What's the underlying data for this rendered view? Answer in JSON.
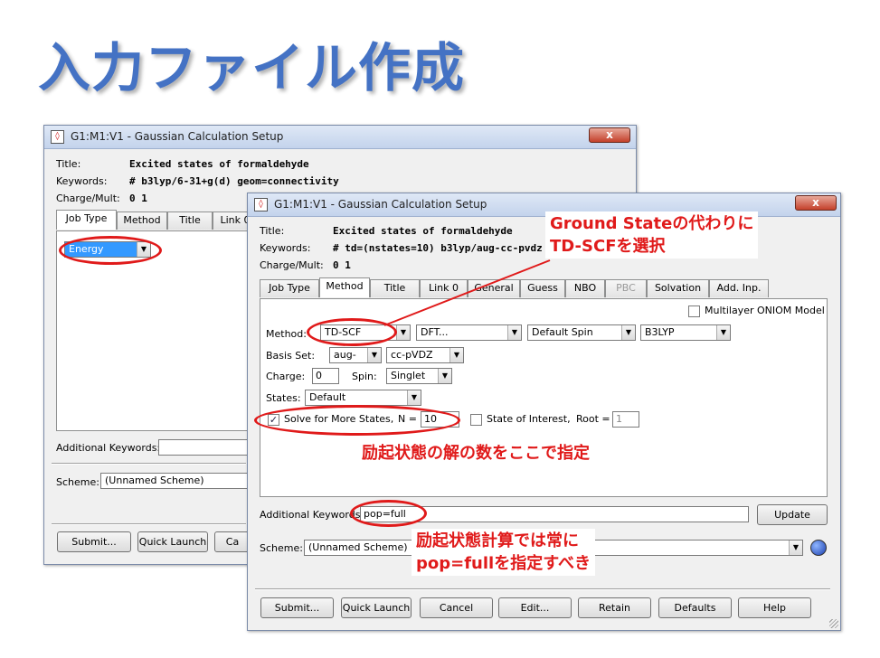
{
  "slide": {
    "title": "入力ファイル作成"
  },
  "back_window": {
    "title": "G1:M1:V1 - Gaussian Calculation Setup",
    "close_label": "x",
    "title_label": "Title:",
    "title_value": "Excited states of formaldehyde",
    "keywords_label": "Keywords:",
    "keywords_value": "# b3lyp/6-31+g(d) geom=connectivity",
    "charge_label": "Charge/Mult:",
    "charge_value": "0 1",
    "tabs": [
      "Job Type",
      "Method",
      "Title",
      "Link 0"
    ],
    "job_type_value": "Energy",
    "additional_keywords_label": "Additional Keywords:",
    "scheme_label": "Scheme:",
    "scheme_value": "(Unnamed Scheme)",
    "buttons": [
      "Submit...",
      "Quick Launch",
      "Ca"
    ]
  },
  "front_window": {
    "title": "G1:M1:V1 - Gaussian Calculation Setup",
    "close_label": "x",
    "title_label": "Title:",
    "title_value": "Excited states of formaldehyde",
    "keywords_label": "Keywords:",
    "keywords_value": "# td=(nstates=10) b3lyp/aug-cc-pvdz g",
    "charge_label": "Charge/Mult:",
    "charge_value": "0 1",
    "tabs": [
      "Job Type",
      "Method",
      "Title",
      "Link 0",
      "General",
      "Guess",
      "NBO",
      "PBC",
      "Solvation",
      "Add. Inp."
    ],
    "active_tab": "Method",
    "disabled_tab": "PBC",
    "multilayer_label": "Multilayer ONIOM Model",
    "method_label": "Method:",
    "method_value": "TD-SCF",
    "method_type": "DFT...",
    "spin_mode": "Default Spin",
    "functional": "B3LYP",
    "basis_label": "Basis Set:",
    "basis_prefix": "aug-",
    "basis_value": "cc-pVDZ",
    "charge_field_label": "Charge:",
    "charge_field_value": "0",
    "spin_label": "Spin:",
    "spin_value": "Singlet",
    "states_label": "States:",
    "states_value": "Default",
    "solve_more_label": "Solve for More States,",
    "n_label": "N =",
    "n_value": "10",
    "state_interest_label": "State of Interest,",
    "root_label": "Root =",
    "root_value": "1",
    "additional_keywords_label": "Additional Keywords:",
    "additional_keywords_value": "pop=full",
    "update_label": "Update",
    "scheme_label": "Scheme:",
    "scheme_value": "(Unnamed Scheme)",
    "buttons": [
      "Submit...",
      "Quick Launch",
      "Cancel",
      "Edit...",
      "Retain",
      "Defaults",
      "Help"
    ]
  },
  "annotations": {
    "td_scf_line1": "Ground Stateの代わりに",
    "td_scf_line2": "TD-SCFを選択",
    "nstates": "励起状態の解の数をここで指定",
    "pop_line1": "励起状態計算では常に",
    "pop_line2": "pop=fullを指定すべき"
  },
  "colors": {
    "title": "#4472c4",
    "annotation": "#e01a1a",
    "selection": "#3399ff"
  }
}
